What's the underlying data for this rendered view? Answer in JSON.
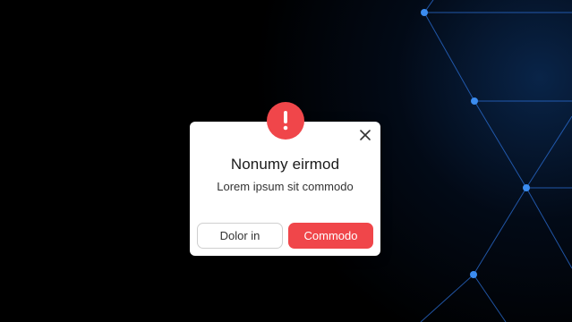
{
  "dialog": {
    "title": "Nonumy eirmod",
    "message": "Lorem ipsum sit commodo",
    "secondary_button": "Dolor in",
    "primary_button": "Commodo"
  },
  "icons": {
    "alert": "exclamation-icon",
    "close": "close-icon"
  },
  "colors": {
    "accent": "#f0464a",
    "background": "#000000",
    "network_lines": "#2b6fd6"
  }
}
